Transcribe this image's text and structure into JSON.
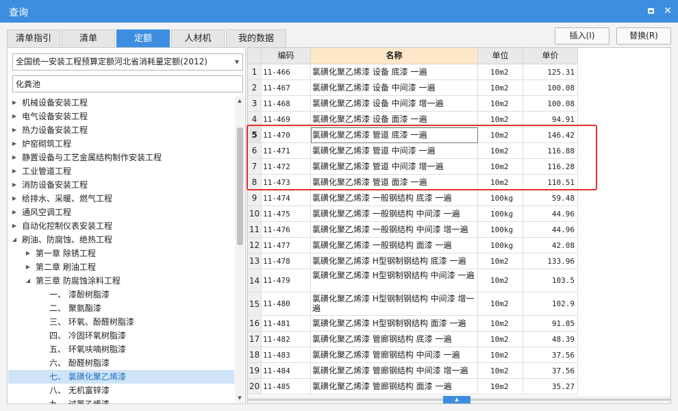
{
  "window": {
    "title": "查询"
  },
  "tabs": [
    "清单指引",
    "清单",
    "定额",
    "人材机",
    "我的数据"
  ],
  "actions": {
    "insert": "插入(I)",
    "replace": "替换(R)"
  },
  "left": {
    "dropdown": "全国统一安装工程预算定额河北省消耗量定额(2012)",
    "search_value": "化粪池",
    "tree": [
      {
        "label": "机械设备安装工程",
        "level": 0,
        "state": "collapsed"
      },
      {
        "label": "电气设备安装工程",
        "level": 0,
        "state": "collapsed"
      },
      {
        "label": "热力设备安装工程",
        "level": 0,
        "state": "collapsed"
      },
      {
        "label": "炉窑砌筑工程",
        "level": 0,
        "state": "collapsed"
      },
      {
        "label": "静置设备与工艺金属结构制作安装工程",
        "level": 0,
        "state": "collapsed"
      },
      {
        "label": "工业管道工程",
        "level": 0,
        "state": "collapsed"
      },
      {
        "label": "消防设备安装工程",
        "level": 0,
        "state": "collapsed"
      },
      {
        "label": "给排水、采暖、燃气工程",
        "level": 0,
        "state": "collapsed"
      },
      {
        "label": "通风空调工程",
        "level": 0,
        "state": "collapsed"
      },
      {
        "label": "自动化控制仪表安装工程",
        "level": 0,
        "state": "collapsed"
      },
      {
        "label": "刷油、防腐蚀、绝热工程",
        "level": 0,
        "state": "expanded"
      },
      {
        "label": "第一章 除锈工程",
        "level": 1,
        "state": "collapsed"
      },
      {
        "label": "第二章 刷油工程",
        "level": 1,
        "state": "collapsed"
      },
      {
        "label": "第三章 防腐蚀涂料工程",
        "level": 1,
        "state": "expanded"
      },
      {
        "label": "一、 漆酚树脂漆",
        "level": 2,
        "state": "leaf"
      },
      {
        "label": "二、 聚氨酯漆",
        "level": 2,
        "state": "leaf"
      },
      {
        "label": "三、 环氧、酚醛树脂漆",
        "level": 2,
        "state": "leaf"
      },
      {
        "label": "四、 冷固环氧树脂漆",
        "level": 2,
        "state": "leaf"
      },
      {
        "label": "五、 环氧呋喃树脂漆",
        "level": 2,
        "state": "leaf"
      },
      {
        "label": "六、 酚醛树脂漆",
        "level": 2,
        "state": "leaf"
      },
      {
        "label": "七、 氯磺化聚乙烯漆",
        "level": 2,
        "state": "leaf",
        "selected": true
      },
      {
        "label": "八、 无机富锌漆",
        "level": 2,
        "state": "leaf"
      },
      {
        "label": "九、 过氯乙烯漆",
        "level": 2,
        "state": "leaf"
      }
    ]
  },
  "grid": {
    "columns": [
      "编码",
      "名称",
      "单位",
      "单价"
    ],
    "rows": [
      {
        "idx": "1",
        "code": "11-466",
        "name": "氯磺化聚乙烯漆 设备 底漆 一遍",
        "unit": "10m2",
        "price": "125.31"
      },
      {
        "idx": "2",
        "code": "11-467",
        "name": "氯磺化聚乙烯漆 设备 中间漆 一遍",
        "unit": "10m2",
        "price": "100.08"
      },
      {
        "idx": "3",
        "code": "11-468",
        "name": "氯磺化聚乙烯漆 设备 中间漆 增一遍",
        "unit": "10m2",
        "price": "100.08"
      },
      {
        "idx": "4",
        "code": "11-469",
        "name": "氯磺化聚乙烯漆 设备 面漆 一遍",
        "unit": "10m2",
        "price": "94.91"
      },
      {
        "idx": "5",
        "code": "11-470",
        "name": "氯磺化聚乙烯漆 管道 底漆 一遍",
        "unit": "10m2",
        "price": "146.42",
        "current": true
      },
      {
        "idx": "6",
        "code": "11-471",
        "name": "氯磺化聚乙烯漆 管道 中间漆 一遍",
        "unit": "10m2",
        "price": "116.88"
      },
      {
        "idx": "7",
        "code": "11-472",
        "name": "氯磺化聚乙烯漆 管道 中间漆 增一遍",
        "unit": "10m2",
        "price": "116.28"
      },
      {
        "idx": "8",
        "code": "11-473",
        "name": "氯磺化聚乙烯漆 管道 面漆 一遍",
        "unit": "10m2",
        "price": "110.51"
      },
      {
        "idx": "9",
        "code": "11-474",
        "name": "氯磺化聚乙烯漆 一般钢结构 底漆 一遍",
        "unit": "100kg",
        "price": "59.48"
      },
      {
        "idx": "10",
        "code": "11-475",
        "name": "氯磺化聚乙烯漆 一般钢结构 中间漆 一遍",
        "unit": "100kg",
        "price": "44.96"
      },
      {
        "idx": "11",
        "code": "11-476",
        "name": "氯磺化聚乙烯漆 一般钢结构 中间漆 增一遍",
        "unit": "100kg",
        "price": "44.96"
      },
      {
        "idx": "12",
        "code": "11-477",
        "name": "氯磺化聚乙烯漆 一般钢结构 面漆 一遍",
        "unit": "100kg",
        "price": "42.08"
      },
      {
        "idx": "13",
        "code": "11-478",
        "name": "氯磺化聚乙烯漆 H型钢制钢结构 底漆 一遍",
        "unit": "10m2",
        "price": "133.96"
      },
      {
        "idx": "14",
        "code": "11-479",
        "name": "氯磺化聚乙烯漆 H型钢制钢结构 中间漆 一遍",
        "unit": "10m2",
        "price": "103.5",
        "tall": true
      },
      {
        "idx": "15",
        "code": "11-480",
        "name": "氯磺化聚乙烯漆 H型钢制钢结构 中间漆 增一遍",
        "unit": "10m2",
        "price": "102.9",
        "tall": true
      },
      {
        "idx": "16",
        "code": "11-481",
        "name": "氯磺化聚乙烯漆 H型钢制钢结构 面漆 一遍",
        "unit": "10m2",
        "price": "91.85"
      },
      {
        "idx": "17",
        "code": "11-482",
        "name": "氯磺化聚乙烯漆 管廊钢结构 底漆 一遍",
        "unit": "10m2",
        "price": "48.39"
      },
      {
        "idx": "18",
        "code": "11-483",
        "name": "氯磺化聚乙烯漆 管廊钢结构 中间漆 一遍",
        "unit": "10m2",
        "price": "37.56"
      },
      {
        "idx": "19",
        "code": "11-484",
        "name": "氯磺化聚乙烯漆 管廊钢结构 中间漆 增一遍",
        "unit": "10m2",
        "price": "37.56"
      },
      {
        "idx": "20",
        "code": "11-485",
        "name": "氯磺化聚乙烯漆 管廊钢结构 面漆 一遍",
        "unit": "10m2",
        "price": "35.27"
      }
    ]
  },
  "colors": {
    "accent": "#3d8ee0",
    "name_header": "#fde8c8",
    "highlight": "#e0302a",
    "selected_tree": "#cfe4f7"
  }
}
